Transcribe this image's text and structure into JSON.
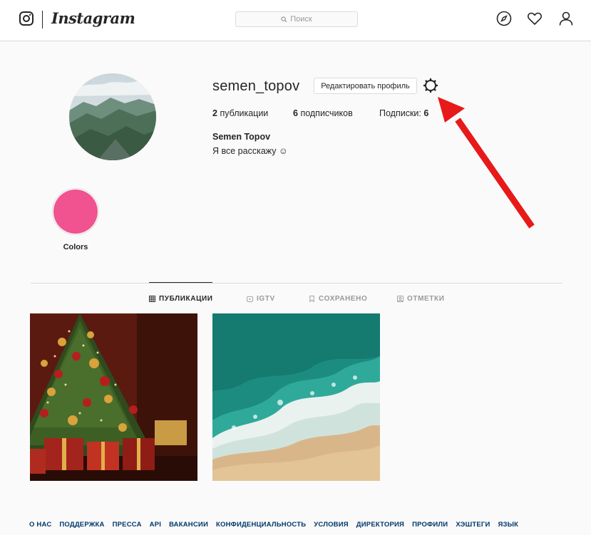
{
  "header": {
    "brand": "Instagram",
    "search_placeholder": "Поиск",
    "icons": [
      "instagram-glyph-icon",
      "search-icon",
      "compass-icon",
      "heart-icon",
      "user-icon"
    ]
  },
  "profile": {
    "username": "semen_topov",
    "edit_button": "Редактировать профиль",
    "posts_count": "2",
    "posts_label": "публикации",
    "followers_count": "6",
    "followers_label": "подписчиков",
    "following_label": "Подписки:",
    "following_count": "6",
    "full_name": "Semen Topov",
    "bio": "Я все расскажу ☺"
  },
  "highlights": [
    {
      "label": "Colors",
      "color": "#f0538f"
    }
  ],
  "tabs": [
    {
      "label": "ПУБЛИКАЦИИ",
      "icon": "grid-icon",
      "active": true
    },
    {
      "label": "IGTV",
      "icon": "igtv-icon",
      "active": false
    },
    {
      "label": "СОХРАНЕНО",
      "icon": "bookmark-icon",
      "active": false
    },
    {
      "label": "ОТМЕТКИ",
      "icon": "tag-icon",
      "active": false
    }
  ],
  "posts": [
    {
      "subject": "christmas-tree-photo"
    },
    {
      "subject": "ocean-waves-photo"
    }
  ],
  "footer": {
    "links": [
      "О НАС",
      "ПОДДЕРЖКА",
      "ПРЕССА",
      "API",
      "ВАКАНСИИ",
      "КОНФИДЕНЦИАЛЬНОСТЬ",
      "УСЛОВИЯ",
      "ДИРЕКТОРИЯ",
      "ПРОФИЛИ",
      "ХЭШТЕГИ",
      "ЯЗЫК"
    ]
  },
  "colors": {
    "accent_arrow": "#e81919",
    "link": "#00376b",
    "border": "#dbdbdb"
  }
}
